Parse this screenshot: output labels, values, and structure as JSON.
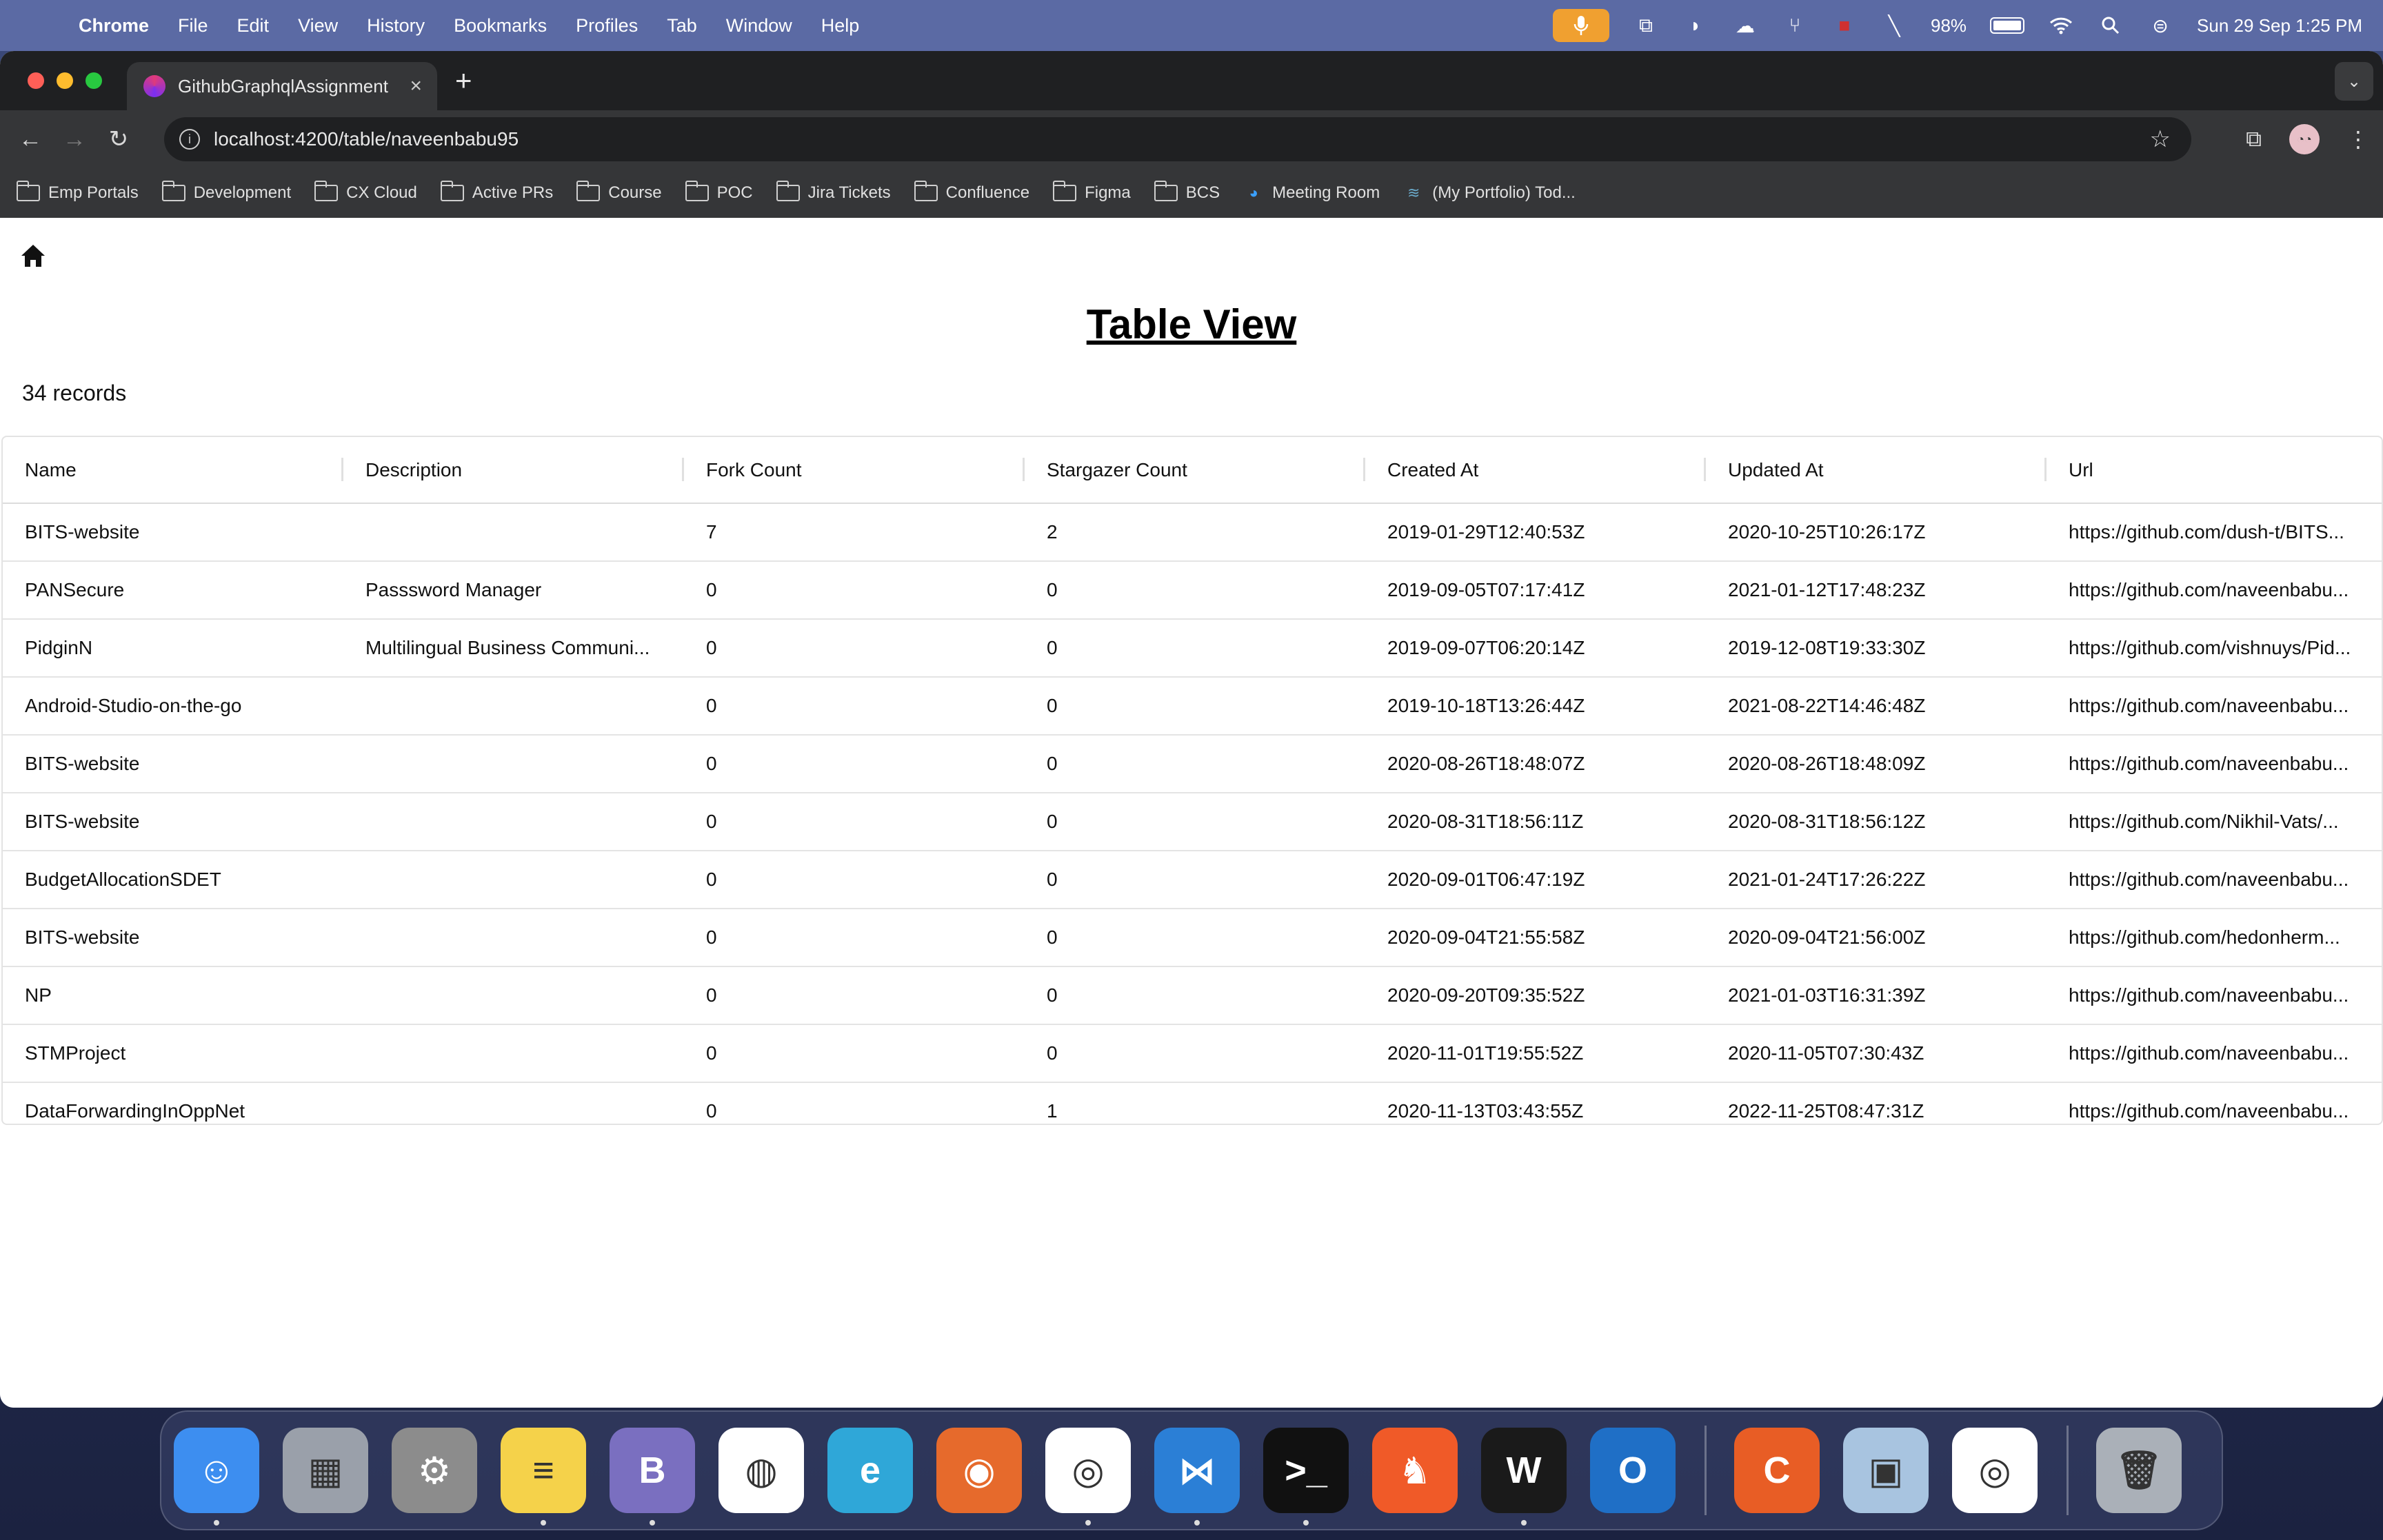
{
  "menubar": {
    "app_name": "Chrome",
    "menus": [
      "File",
      "Edit",
      "View",
      "History",
      "Bookmarks",
      "Profiles",
      "Tab",
      "Window",
      "Help"
    ],
    "battery": "98%",
    "datetime": "Sun 29 Sep  1:25 PM"
  },
  "browser": {
    "tab_title": "GithubGraphqlAssignment",
    "url": "localhost:4200/table/naveenbabu95",
    "bookmarks": [
      "Emp Portals",
      "Development",
      "CX Cloud",
      "Active PRs",
      "Course",
      "POC",
      "Jira Tickets",
      "Confluence",
      "Figma",
      "BCS"
    ],
    "bookmark_links": [
      "Meeting Room",
      "(My Portfolio) Tod..."
    ]
  },
  "page": {
    "title": "Table View",
    "record_count": "34 records",
    "columns": [
      "Name",
      "Description",
      "Fork Count",
      "Stargazer Count",
      "Created At",
      "Updated At",
      "Url"
    ],
    "rows": [
      {
        "name": "BITS-website",
        "description": "",
        "fork": "7",
        "stars": "2",
        "created": "2019-01-29T12:40:53Z",
        "updated": "2020-10-25T10:26:17Z",
        "url": "https://github.com/dush-t/BITS..."
      },
      {
        "name": "PANSecure",
        "description": "Passsword Manager",
        "fork": "0",
        "stars": "0",
        "created": "2019-09-05T07:17:41Z",
        "updated": "2021-01-12T17:48:23Z",
        "url": "https://github.com/naveenbabu..."
      },
      {
        "name": "PidginN",
        "description": "Multilingual Business Communi...",
        "fork": "0",
        "stars": "0",
        "created": "2019-09-07T06:20:14Z",
        "updated": "2019-12-08T19:33:30Z",
        "url": "https://github.com/vishnuys/Pid..."
      },
      {
        "name": "Android-Studio-on-the-go",
        "description": "",
        "fork": "0",
        "stars": "0",
        "created": "2019-10-18T13:26:44Z",
        "updated": "2021-08-22T14:46:48Z",
        "url": "https://github.com/naveenbabu..."
      },
      {
        "name": "BITS-website",
        "description": "",
        "fork": "0",
        "stars": "0",
        "created": "2020-08-26T18:48:07Z",
        "updated": "2020-08-26T18:48:09Z",
        "url": "https://github.com/naveenbabu..."
      },
      {
        "name": "BITS-website",
        "description": "",
        "fork": "0",
        "stars": "0",
        "created": "2020-08-31T18:56:11Z",
        "updated": "2020-08-31T18:56:12Z",
        "url": "https://github.com/Nikhil-Vats/..."
      },
      {
        "name": "BudgetAllocationSDET",
        "description": "",
        "fork": "0",
        "stars": "0",
        "created": "2020-09-01T06:47:19Z",
        "updated": "2021-01-24T17:26:22Z",
        "url": "https://github.com/naveenbabu..."
      },
      {
        "name": "BITS-website",
        "description": "",
        "fork": "0",
        "stars": "0",
        "created": "2020-09-04T21:55:58Z",
        "updated": "2020-09-04T21:56:00Z",
        "url": "https://github.com/hedonherm..."
      },
      {
        "name": "NP",
        "description": "",
        "fork": "0",
        "stars": "0",
        "created": "2020-09-20T09:35:52Z",
        "updated": "2021-01-03T16:31:39Z",
        "url": "https://github.com/naveenbabu..."
      },
      {
        "name": "STMProject",
        "description": "",
        "fork": "0",
        "stars": "0",
        "created": "2020-11-01T19:55:52Z",
        "updated": "2020-11-05T07:30:43Z",
        "url": "https://github.com/naveenbabu..."
      },
      {
        "name": "DataForwardingInOppNet",
        "description": "",
        "fork": "0",
        "stars": "1",
        "created": "2020-11-13T03:43:55Z",
        "updated": "2022-11-25T08:47:31Z",
        "url": "https://github.com/naveenbabu..."
      }
    ]
  },
  "dock": {
    "apps": [
      {
        "icon": "finder-icon",
        "color": "#3d8ef0",
        "glyph": "☺",
        "running": true
      },
      {
        "icon": "launchpad-icon",
        "color": "#9aa0aa",
        "glyph": "▦",
        "running": false
      },
      {
        "icon": "system-settings-icon",
        "color": "#8c8c8c",
        "glyph": "⚙",
        "running": false
      },
      {
        "icon": "notes-icon",
        "color": "#f5d24a",
        "glyph": "≡",
        "running": true
      },
      {
        "icon": "bbedit-icon",
        "color": "#7a6fc0",
        "glyph": "B",
        "running": true
      },
      {
        "icon": "compass-icon",
        "color": "#ffffff",
        "glyph": "◍",
        "running": false
      },
      {
        "icon": "edge-icon",
        "color": "#2fa7d8",
        "glyph": "e",
        "running": false
      },
      {
        "icon": "firefox-icon",
        "color": "#e66a2c",
        "glyph": "◉",
        "running": false
      },
      {
        "icon": "chrome-icon",
        "color": "#ffffff",
        "glyph": "◎",
        "running": true
      },
      {
        "icon": "vscode-icon",
        "color": "#2b7fd6",
        "glyph": "⋈",
        "running": true
      },
      {
        "icon": "terminal-icon",
        "color": "#111111",
        "glyph": ">_",
        "running": true
      },
      {
        "icon": "brave-icon",
        "color": "#f05a28",
        "glyph": "♞",
        "running": false
      },
      {
        "icon": "webex-icon",
        "color": "#1a1a1a",
        "glyph": "W",
        "running": true
      },
      {
        "icon": "outlook-icon",
        "color": "#1f6fc6",
        "glyph": "O",
        "running": false
      },
      {
        "icon": "postman-icon",
        "color": "#e85d25",
        "glyph": "C",
        "running": false
      },
      {
        "icon": "preview-icon",
        "color": "#a8c4e0",
        "glyph": "▣",
        "running": false
      },
      {
        "icon": "chrome-alt-icon",
        "color": "#ffffff",
        "glyph": "◎",
        "running": false
      },
      {
        "icon": "trash-icon",
        "color": "#aab0b8",
        "glyph": "🗑",
        "running": false
      }
    ]
  }
}
